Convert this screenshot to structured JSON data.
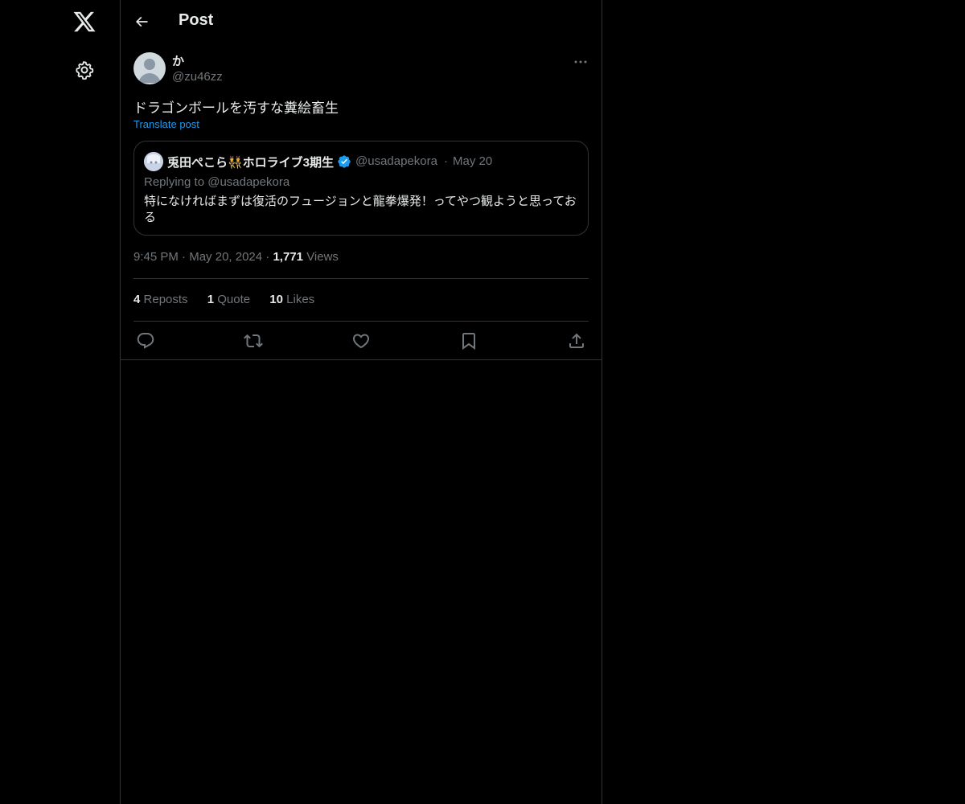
{
  "header": {
    "title": "Post"
  },
  "post": {
    "author_name": "か",
    "author_handle": "@zu46zz",
    "text": "ドラゴンボールを汚すな糞絵畜生",
    "translate_label": "Translate post",
    "time": "9:45 PM",
    "date": "May 20, 2024",
    "views_count": "1,771",
    "views_label": "Views"
  },
  "quote": {
    "name": "兎田ぺこら👯ホロライブ3期生",
    "handle": "@usadapekora",
    "date": "May 20",
    "replying_to": "Replying to @usadapekora",
    "text": "特になければまずは復活のフュージョンと龍拳爆発！ってやつ観ようと思っておる"
  },
  "stats": {
    "reposts_count": "4",
    "reposts_label": "Reposts",
    "quotes_count": "1",
    "quotes_label": "Quote",
    "likes_count": "10",
    "likes_label": "Likes"
  },
  "colors": {
    "background": "#000000",
    "accent": "#1d9bf0",
    "muted": "#71767b",
    "border": "#2f3336"
  },
  "icons": [
    "x-logo-icon",
    "settings-icon",
    "back-arrow-icon",
    "more-icon",
    "verified-icon",
    "reply-icon",
    "repost-icon",
    "like-icon",
    "bookmark-icon",
    "share-icon"
  ]
}
